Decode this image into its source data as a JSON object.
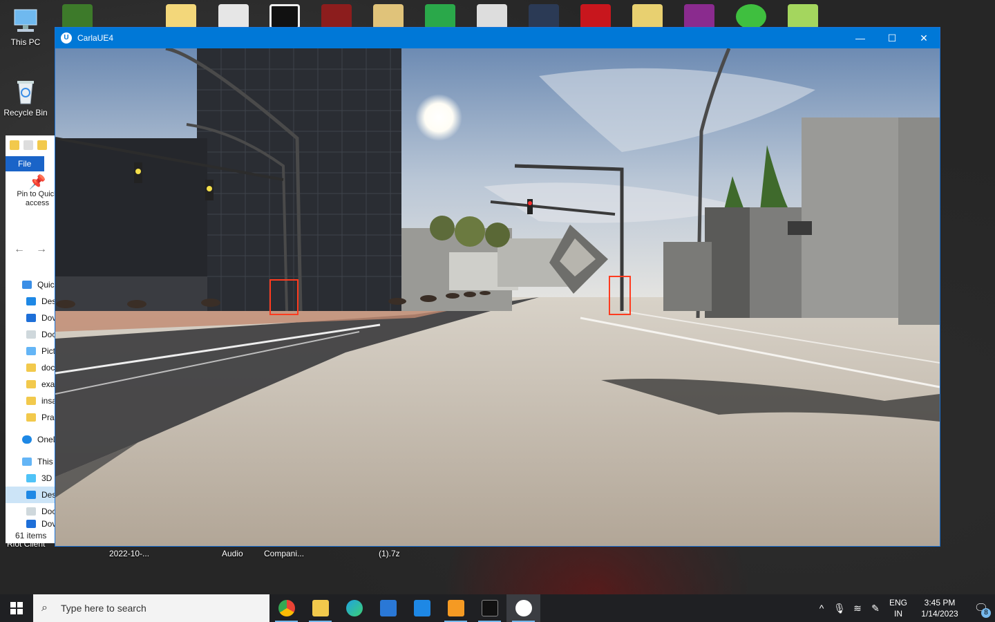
{
  "desktop": {
    "icons": [
      {
        "label": "This PC",
        "icon": "this-pc-icon"
      },
      {
        "label": "Recycle Bin",
        "icon": "recycle-bin-icon"
      }
    ],
    "bottom_labels": [
      "Riot Client",
      "2022-10-...",
      "Audio",
      "Compani...",
      "(1).7z"
    ]
  },
  "explorer": {
    "file_tab": "File",
    "pin_label": "Pin to Quick access",
    "tree": [
      "Quic",
      "Des",
      "Dov",
      "Doc",
      "Pict",
      "doc",
      "exa",
      "insa",
      "Pra",
      "OneD",
      "This",
      "3D",
      "Des",
      "Doc",
      "Dov"
    ],
    "status": "61 items"
  },
  "carla_window": {
    "title": "CarlaUE4",
    "minimize": "—",
    "maximize": "☐",
    "close": "✕"
  },
  "taskbar": {
    "search_placeholder": "Type here to search",
    "apps": [
      "chrome",
      "file-explorer",
      "edge",
      "mail",
      "store",
      "sublime-text",
      "terminal",
      "unreal-engine"
    ],
    "language_top": "ENG",
    "language_bottom": "IN",
    "time": "3:45 PM",
    "date": "1/14/2023",
    "notification_count": "8"
  },
  "colors": {
    "accent": "#0078d7",
    "taskbar": "#1f2023",
    "detection_box": "#ff3b1f"
  }
}
